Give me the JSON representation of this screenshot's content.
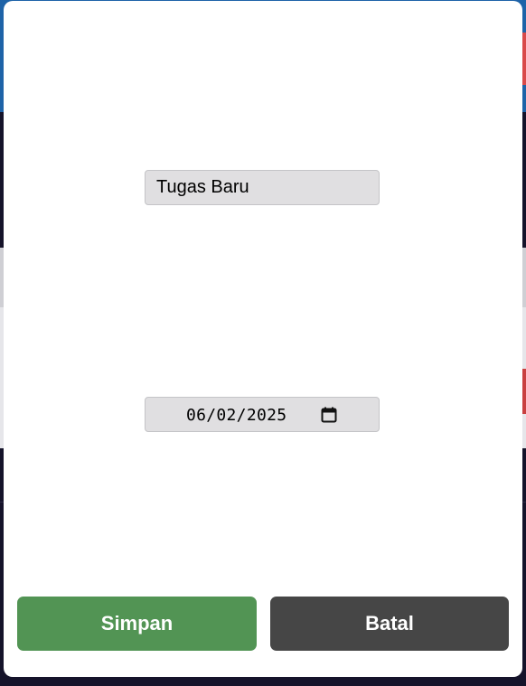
{
  "form": {
    "task_title_value": "Tugas Baru",
    "due_date_value": "06/02/2025"
  },
  "buttons": {
    "save_label": "Simpan",
    "cancel_label": "Batal"
  },
  "icons": {
    "date": "calendar-icon"
  },
  "colors": {
    "save_button": "#529454",
    "cancel_button": "#464646",
    "field_background": "#e0dfe1",
    "backdrop": "#15132a",
    "background_header": "#1e63a8"
  }
}
